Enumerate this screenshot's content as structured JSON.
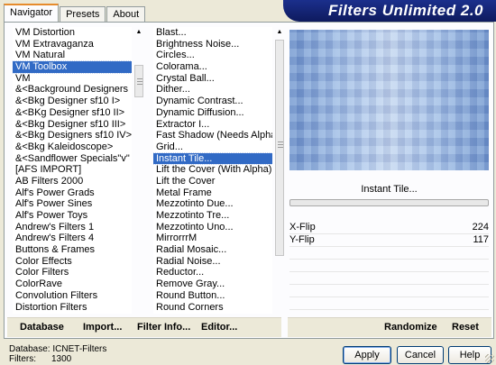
{
  "tabs": [
    {
      "label": "Navigator",
      "active": true
    },
    {
      "label": "Presets",
      "active": false
    },
    {
      "label": "About",
      "active": false
    }
  ],
  "banner": {
    "title": "Filters Unlimited 2.0"
  },
  "categories": [
    "VM Distortion",
    "VM Extravaganza",
    "VM Natural",
    "VM Toolbox",
    "VM",
    "&<Background Designers IV>",
    "&<Bkg Designer sf10 I>",
    "&<BKg Designer sf10 II>",
    "&<Bkg Designer sf10 III>",
    "&<Bkg Designers sf10 IV>",
    "&<Bkg Kaleidoscope>",
    "&<Sandflower Specials\"v\" >",
    "[AFS IMPORT]",
    "AB Filters 2000",
    "Alf's Power Grads",
    "Alf's Power Sines",
    "Alf's Power Toys",
    "Andrew's Filters 1",
    "Andrew's Filters 4",
    "Buttons & Frames",
    "Color Effects",
    "Color Filters",
    "ColorRave",
    "Convolution Filters",
    "Distortion Filters"
  ],
  "selected_category": "VM Toolbox",
  "filters": [
    "Blast...",
    "Brightness Noise...",
    "Circles...",
    "Colorama...",
    "Crystal Ball...",
    "Dither...",
    "Dynamic Contrast...",
    "Dynamic Diffusion...",
    "Extractor I...",
    "Fast Shadow (Needs Alpha)",
    "Grid...",
    "Instant Tile...",
    "Lift the Cover (With Alpha)",
    "Lift the Cover",
    "Metal Frame",
    "Mezzotinto Due...",
    "Mezzotinto Tre...",
    "Mezzotinto Uno...",
    "MirrorrrM",
    "Radial Mosaic...",
    "Radial Noise...",
    "Reductor...",
    "Remove Gray...",
    "Round Button...",
    "Round Corners"
  ],
  "selected_filter": "Instant Tile...",
  "preview": {
    "filter_name": "Instant Tile..."
  },
  "params": [
    {
      "name": "X-Flip",
      "value": "224"
    },
    {
      "name": "Y-Flip",
      "value": "117"
    }
  ],
  "left_toolbar": {
    "database": "Database",
    "import": "Import...",
    "filter_info": "Filter Info...",
    "editor": "Editor..."
  },
  "right_toolbar": {
    "randomize": "Randomize",
    "reset": "Reset"
  },
  "status": {
    "database_label": "Database:",
    "database_value": "ICNET-Filters",
    "filters_label": "Filters:",
    "filters_value": "1300"
  },
  "buttons": {
    "apply": "Apply",
    "cancel": "Cancel",
    "help": "Help"
  }
}
